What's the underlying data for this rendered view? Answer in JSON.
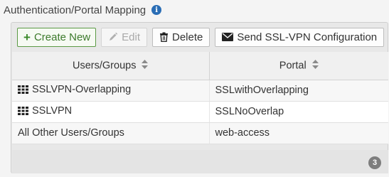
{
  "section": {
    "title": "Authentication/Portal Mapping",
    "info_icon": "info-icon"
  },
  "toolbar": {
    "create_label": "Create New",
    "edit_label": "Edit",
    "delete_label": "Delete",
    "send_label": "Send SSL-VPN Configuration"
  },
  "table": {
    "headers": [
      "Users/Groups",
      "Portal"
    ],
    "rows": [
      {
        "group": "SSLVPN-Overlapping",
        "portal": "SSLwithOverlapping",
        "icon": "user-group-icon"
      },
      {
        "group": "SSLVPN",
        "portal": "SSLNoOverlap",
        "icon": "user-group-icon"
      },
      {
        "group": "All Other Users/Groups",
        "portal": "web-access",
        "icon": ""
      }
    ]
  },
  "footer": {
    "count": "3"
  },
  "colors": {
    "create_accent": "#3b8a2a",
    "info_blue": "#2a6db5",
    "badge_gray": "#7d7d7d"
  }
}
